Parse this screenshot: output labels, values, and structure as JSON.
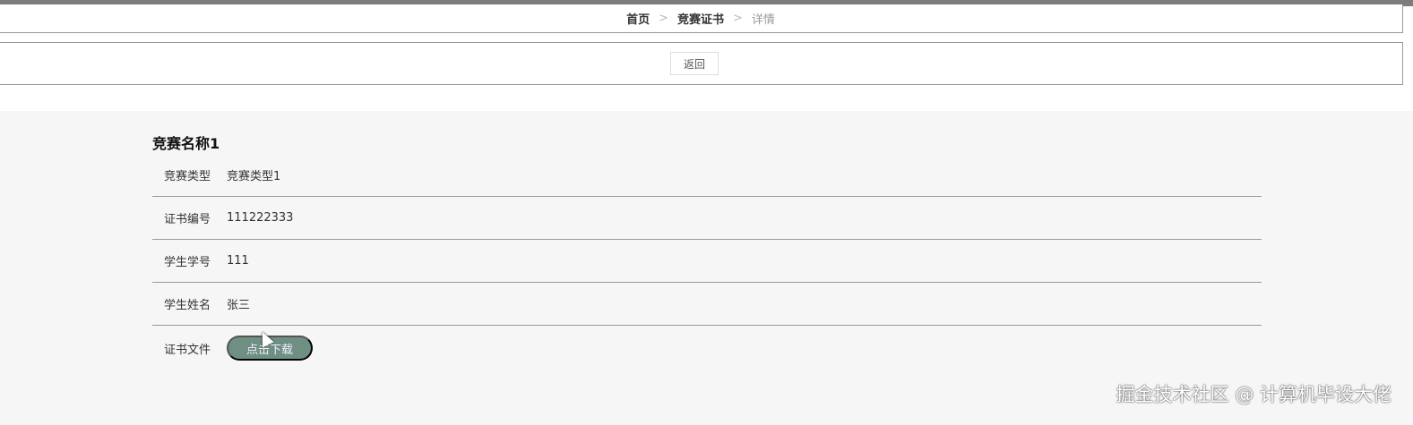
{
  "breadcrumb": {
    "home": "首页",
    "section": "竞赛证书",
    "current": "详情",
    "separator": ">"
  },
  "actions": {
    "back_label": "返回"
  },
  "detail": {
    "title": "竞赛名称1",
    "fields": [
      {
        "label": "竞赛类型",
        "value": "竞赛类型1"
      },
      {
        "label": "证书编号",
        "value": "111222333"
      },
      {
        "label": "学生学号",
        "value": "111"
      },
      {
        "label": "学生姓名",
        "value": "张三"
      }
    ],
    "file_label": "证书文件",
    "download_label": "点击下载"
  },
  "watermark": "掘金技术社区 @ 计算机毕设大佬",
  "colors": {
    "download_button": "#6f8f83",
    "background": "#f6f6f6"
  }
}
